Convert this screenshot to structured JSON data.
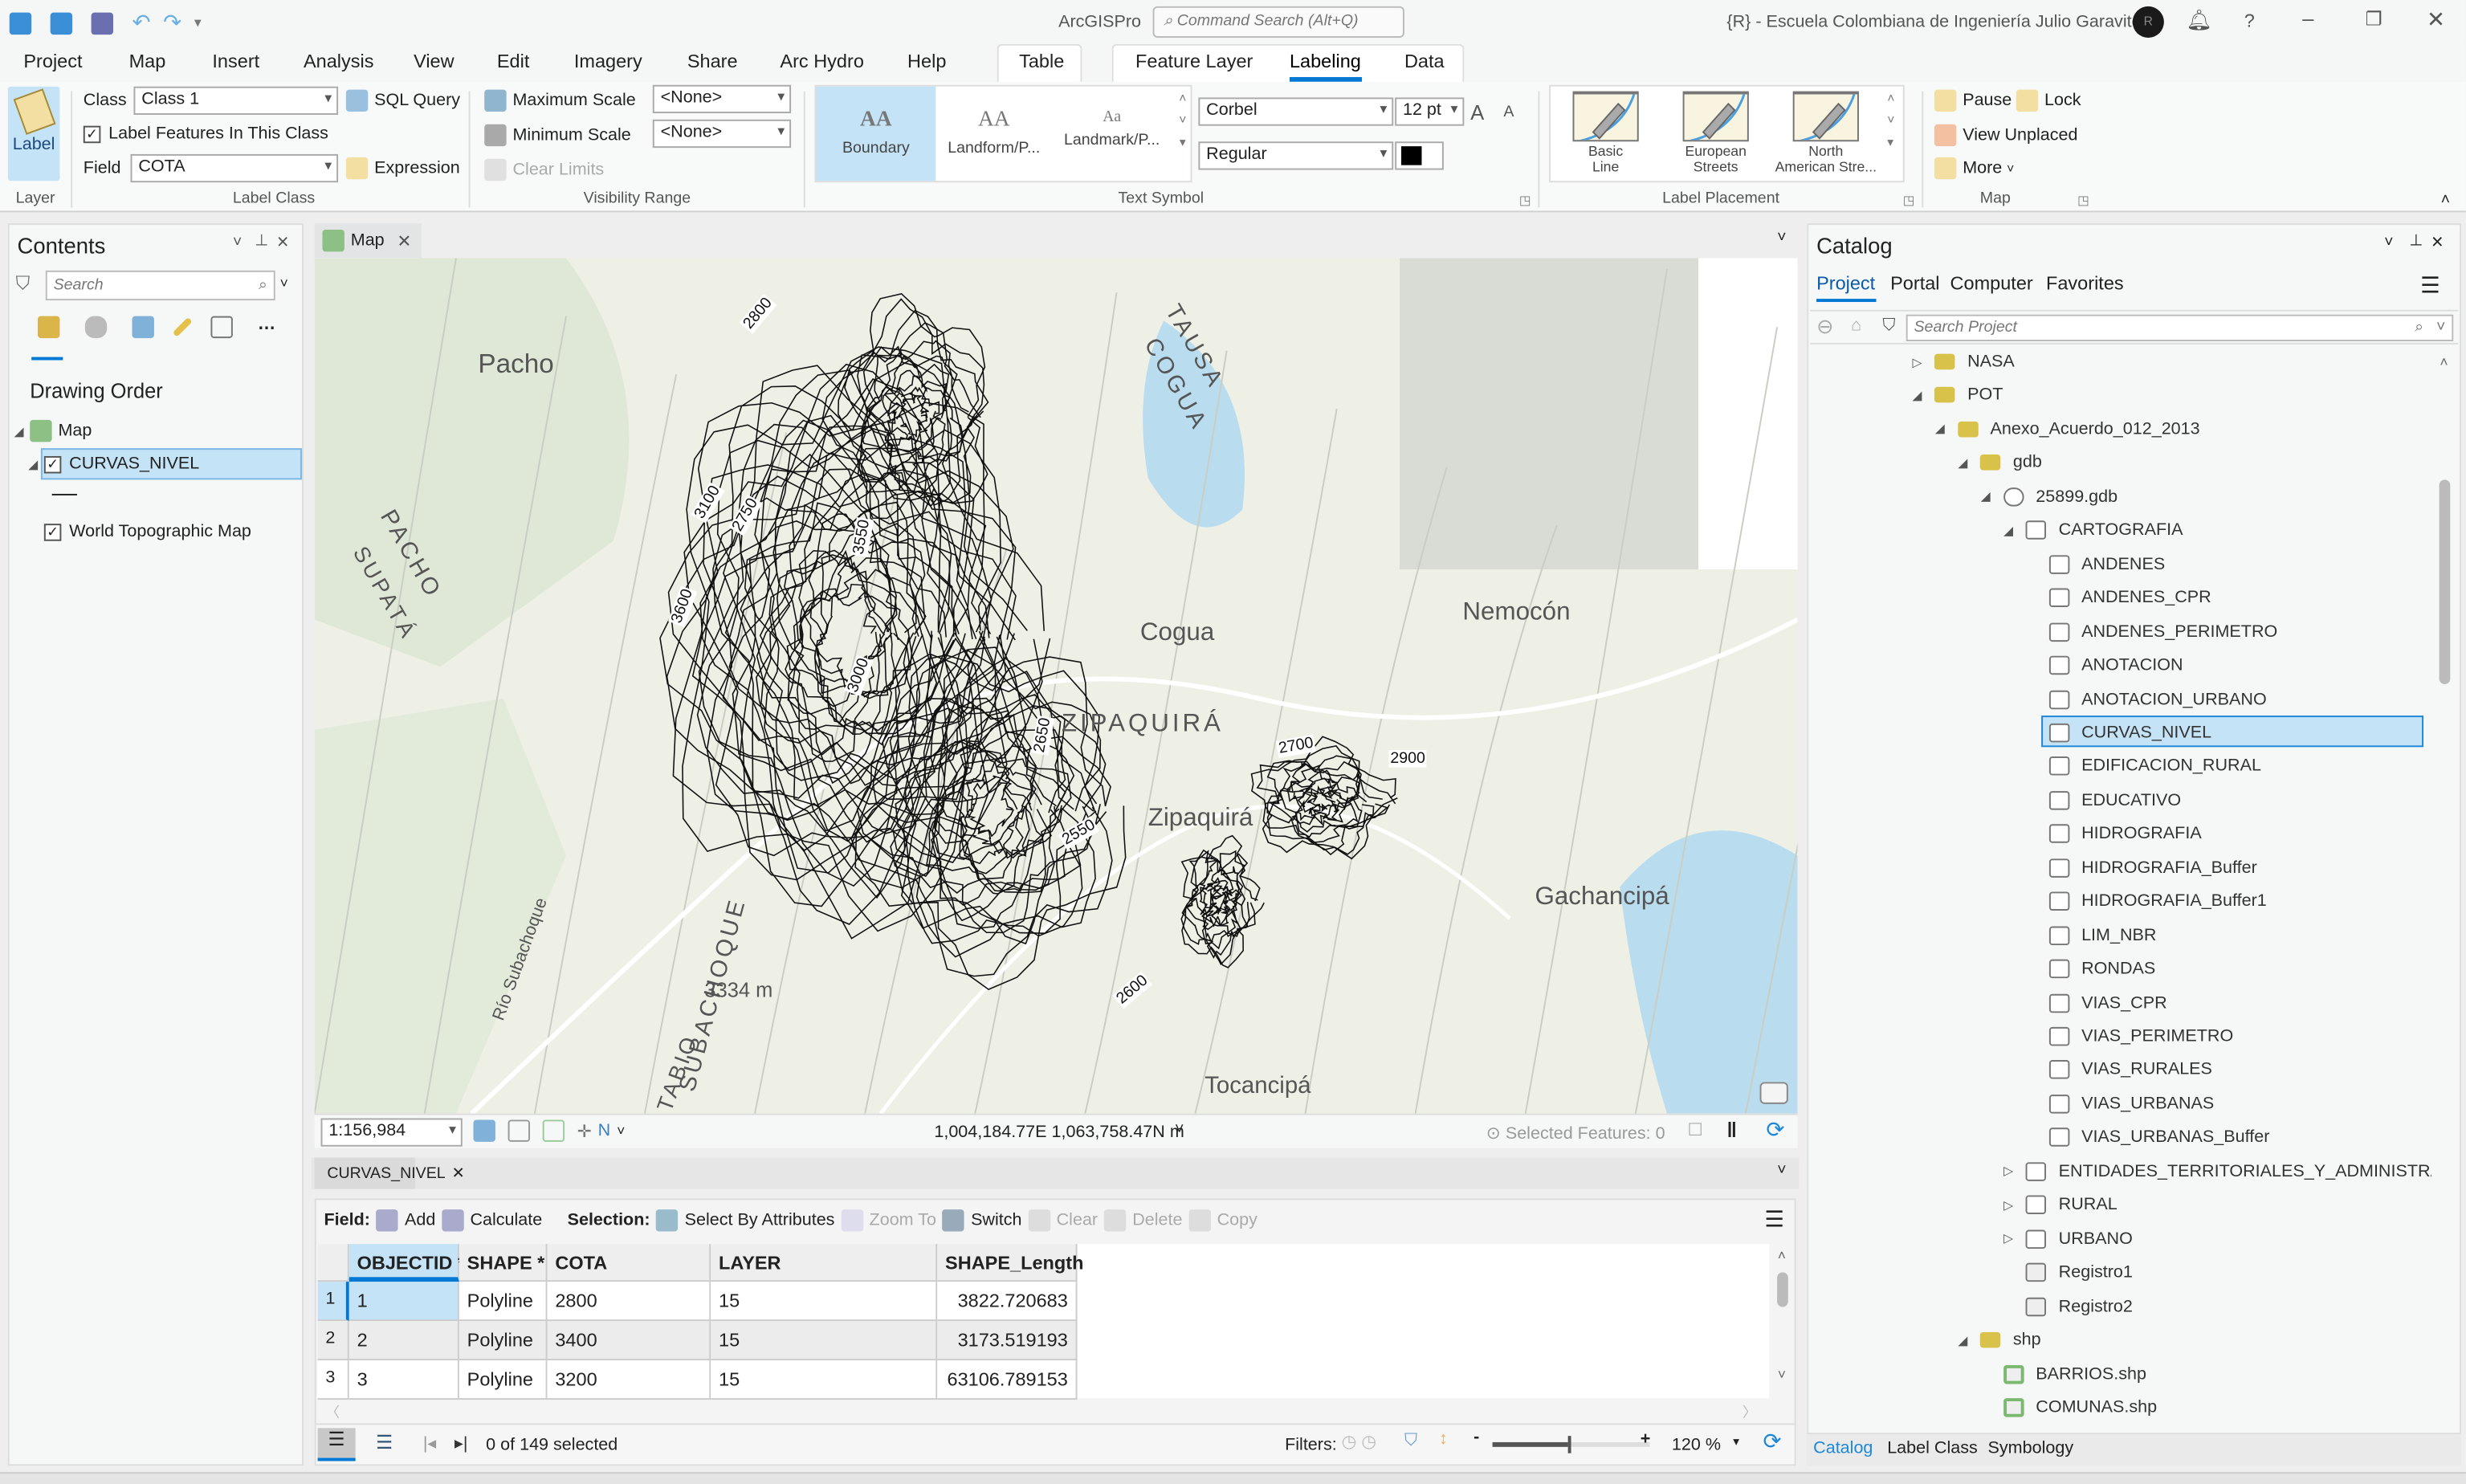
{
  "app": {
    "name": "ArcGISPro",
    "search_placeholder": "Command Search (Alt+Q)",
    "user": "{R} - Escuela Colombiana de Ingeniería Julio Garavito",
    "avatar": "R"
  },
  "menu": [
    "Project",
    "Map",
    "Insert",
    "Analysis",
    "View",
    "Edit",
    "Imagery",
    "Share",
    "Arc Hydro",
    "Help"
  ],
  "context_tabs": {
    "table": "Table",
    "feature_layer": "Feature Layer",
    "labeling": "Labeling",
    "data": "Data"
  },
  "ribbon": {
    "layer": {
      "label_button": "Label",
      "group": "Layer"
    },
    "label_class": {
      "class_label": "Class",
      "class_value": "Class 1",
      "sql": "SQL Query",
      "label_features": "Label Features In This Class",
      "field_label": "Field",
      "field_value": "COTA",
      "expression": "Expression",
      "group": "Label Class"
    },
    "visibility": {
      "max": "Maximum Scale",
      "min": "Minimum Scale",
      "max_value": "<None>",
      "min_value": "<None>",
      "clear": "Clear Limits",
      "group": "Visibility Range"
    },
    "text_symbol": {
      "styles": [
        {
          "preview": "AA",
          "label": "Boundary"
        },
        {
          "preview": "AA",
          "label": "Landform/P..."
        },
        {
          "preview": "Aa",
          "label": "Landmark/P..."
        }
      ],
      "font": "Corbel",
      "size": "12 pt",
      "style": "Regular",
      "grow": "A",
      "shrink": "A",
      "group": "Text Symbol",
      "color": "#000000"
    },
    "placement": {
      "items": [
        {
          "line1": "Basic",
          "line2": "Line"
        },
        {
          "line1": "European",
          "line2": "Streets"
        },
        {
          "line1": "North",
          "line2": "American Stre..."
        }
      ],
      "group": "Label Placement"
    },
    "map": {
      "pause": "Pause",
      "lock": "Lock",
      "view_unplaced": "View Unplaced",
      "more": "More",
      "group": "Map"
    }
  },
  "contents": {
    "title": "Contents",
    "search_placeholder": "Search",
    "heading": "Drawing Order",
    "items": [
      "Map",
      "CURVAS_NIVEL",
      "World Topographic Map"
    ]
  },
  "map_view": {
    "tab": "Map",
    "scale": "1:156,984",
    "coords": "1,004,184.77E 1,063,758.47N m",
    "selected": "Selected Features: 0",
    "labels": [
      "Pacho",
      "TAUSA",
      "COGUA",
      "PACHO",
      "SUPATÁ",
      "Cogua",
      "Nemocón",
      "ZIPAQUIRÁ",
      "Zipaquirá",
      "Gachancipá",
      "Tocancipá",
      "3334 m",
      "Río Subachoque",
      "SUBACHOQUE",
      "TABIO"
    ],
    "contour_labels": [
      "2800",
      "2900",
      "3100",
      "2750",
      "3600",
      "3550",
      "2650",
      "2700",
      "2550",
      "2600",
      "3000"
    ]
  },
  "table": {
    "tab": "CURVAS_NIVEL",
    "field_label": "Field:",
    "add": "Add",
    "calculate": "Calculate",
    "selection_label": "Selection:",
    "select_by_attr": "Select By Attributes",
    "zoom_to": "Zoom To",
    "switch": "Switch",
    "clear": "Clear",
    "delete": "Delete",
    "copy": "Copy",
    "columns": [
      "OBJECTID *",
      "SHAPE *",
      "COTA",
      "LAYER",
      "SHAPE_Length"
    ],
    "rows": [
      [
        "1",
        "1",
        "Polyline",
        "2800",
        "15",
        "3822.720683"
      ],
      [
        "2",
        "2",
        "Polyline",
        "3400",
        "15",
        "3173.519193"
      ],
      [
        "3",
        "3",
        "Polyline",
        "3200",
        "15",
        "63106.789153"
      ]
    ],
    "status": "0 of 149 selected",
    "filters": "Filters:",
    "zoom": "120 %"
  },
  "catalog": {
    "title": "Catalog",
    "tabs": [
      "Project",
      "Portal",
      "Computer",
      "Favorites"
    ],
    "search_placeholder": "Search Project",
    "tree": [
      {
        "t": "NASA",
        "lvl": 0,
        "k": "folder",
        "e": "c"
      },
      {
        "t": "POT",
        "lvl": 0,
        "k": "folder",
        "e": "o"
      },
      {
        "t": "Anexo_Acuerdo_012_2013",
        "lvl": 1,
        "k": "folder",
        "e": "o"
      },
      {
        "t": "gdb",
        "lvl": 2,
        "k": "folder",
        "e": "o"
      },
      {
        "t": "25899.gdb",
        "lvl": 3,
        "k": "gdb",
        "e": "o"
      },
      {
        "t": "CARTOGRAFIA",
        "lvl": 4,
        "k": "fds",
        "e": "o"
      },
      {
        "t": "ANDENES",
        "lvl": 5,
        "k": "fc"
      },
      {
        "t": "ANDENES_CPR",
        "lvl": 5,
        "k": "fc"
      },
      {
        "t": "ANDENES_PERIMETRO",
        "lvl": 5,
        "k": "fc"
      },
      {
        "t": "ANOTACION",
        "lvl": 5,
        "k": "fc"
      },
      {
        "t": "ANOTACION_URBANO",
        "lvl": 5,
        "k": "fc"
      },
      {
        "t": "CURVAS_NIVEL",
        "lvl": 5,
        "k": "fc",
        "sel": true
      },
      {
        "t": "EDIFICACION_RURAL",
        "lvl": 5,
        "k": "fc"
      },
      {
        "t": "EDUCATIVO",
        "lvl": 5,
        "k": "fc"
      },
      {
        "t": "HIDROGRAFIA",
        "lvl": 5,
        "k": "fc"
      },
      {
        "t": "HIDROGRAFIA_Buffer",
        "lvl": 5,
        "k": "fc"
      },
      {
        "t": "HIDROGRAFIA_Buffer1",
        "lvl": 5,
        "k": "fc"
      },
      {
        "t": "LIM_NBR",
        "lvl": 5,
        "k": "fc"
      },
      {
        "t": "RONDAS",
        "lvl": 5,
        "k": "fc"
      },
      {
        "t": "VIAS_CPR",
        "lvl": 5,
        "k": "fc"
      },
      {
        "t": "VIAS_PERIMETRO",
        "lvl": 5,
        "k": "fc"
      },
      {
        "t": "VIAS_RURALES",
        "lvl": 5,
        "k": "fc"
      },
      {
        "t": "VIAS_URBANAS",
        "lvl": 5,
        "k": "fc"
      },
      {
        "t": "VIAS_URBANAS_Buffer",
        "lvl": 5,
        "k": "fc"
      },
      {
        "t": "ENTIDADES_TERRITORIALES_Y_ADMINISTRAT...",
        "lvl": 4,
        "k": "fds",
        "e": "c"
      },
      {
        "t": "RURAL",
        "lvl": 4,
        "k": "fds",
        "e": "c"
      },
      {
        "t": "URBANO",
        "lvl": 4,
        "k": "fds",
        "e": "c"
      },
      {
        "t": "Registro1",
        "lvl": 4,
        "k": "tbl"
      },
      {
        "t": "Registro2",
        "lvl": 4,
        "k": "tbl"
      },
      {
        "t": "shp",
        "lvl": 2,
        "k": "folder",
        "e": "o"
      },
      {
        "t": "BARRIOS.shp",
        "lvl": 3,
        "k": "shp"
      },
      {
        "t": "COMUNAS.shp",
        "lvl": 3,
        "k": "shp"
      }
    ],
    "bottom_tabs": [
      "Catalog",
      "Label Class",
      "Symbology"
    ]
  },
  "colors": {
    "accent": "#0078d4",
    "selected": "#c5e3f6",
    "folder": "#d9c24a"
  }
}
